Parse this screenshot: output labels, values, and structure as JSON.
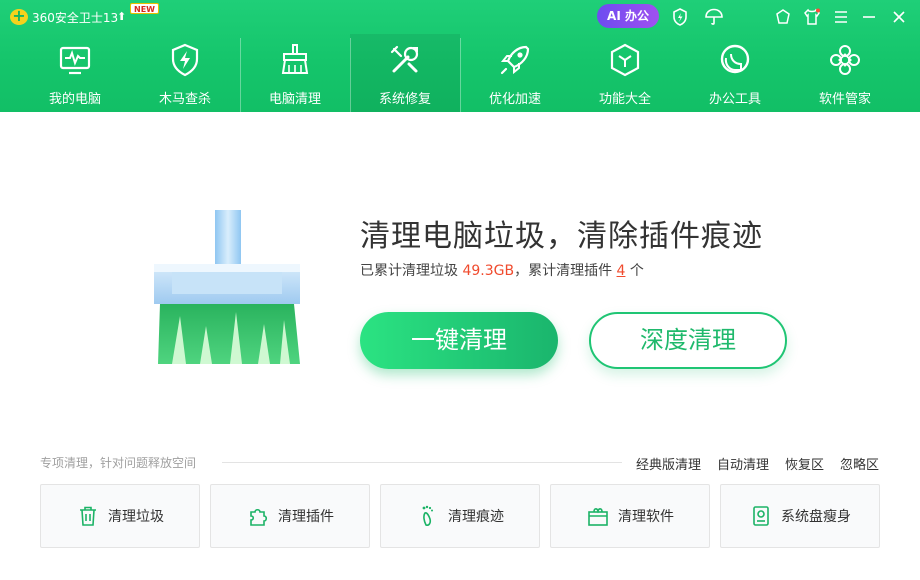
{
  "app": {
    "title": "360安全卫士13",
    "new_badge": "NEW",
    "ai_button": "AI 办公"
  },
  "nav": {
    "items": [
      {
        "label": "我的电脑",
        "icon": "monitor-icon"
      },
      {
        "label": "木马查杀",
        "icon": "shield-bolt-icon"
      },
      {
        "label": "电脑清理",
        "icon": "broom-icon"
      },
      {
        "label": "系统修复",
        "icon": "tools-icon"
      },
      {
        "label": "优化加速",
        "icon": "rocket-icon"
      },
      {
        "label": "功能大全",
        "icon": "cube-icon"
      },
      {
        "label": "办公工具",
        "icon": "office-icon"
      },
      {
        "label": "软件管家",
        "icon": "apps-icon"
      }
    ],
    "active": "系统修复"
  },
  "hero": {
    "title": "清理电脑垃圾，清除插件痕迹",
    "sub_prefix": "已累计清理垃圾",
    "junk_size": "49.3GB",
    "sub_middle": "，累计清理插件",
    "plugin_count": "4",
    "sub_suffix": "个",
    "primary_button": "一键清理",
    "secondary_button": "深度清理"
  },
  "special": {
    "label": "专项清理，针对问题释放空间",
    "links": [
      "经典版清理",
      "自动清理",
      "恢复区",
      "忽略区"
    ],
    "tools": [
      {
        "label": "清理垃圾",
        "icon": "trash-icon"
      },
      {
        "label": "清理插件",
        "icon": "puzzle-icon"
      },
      {
        "label": "清理痕迹",
        "icon": "footprint-icon"
      },
      {
        "label": "清理软件",
        "icon": "software-box-icon"
      },
      {
        "label": "系统盘瘦身",
        "icon": "disk-icon"
      }
    ]
  },
  "colors": {
    "brand_green": "#17c56b",
    "accent_orange": "#f04b2e",
    "ai_purple": "#7a4cf0"
  }
}
